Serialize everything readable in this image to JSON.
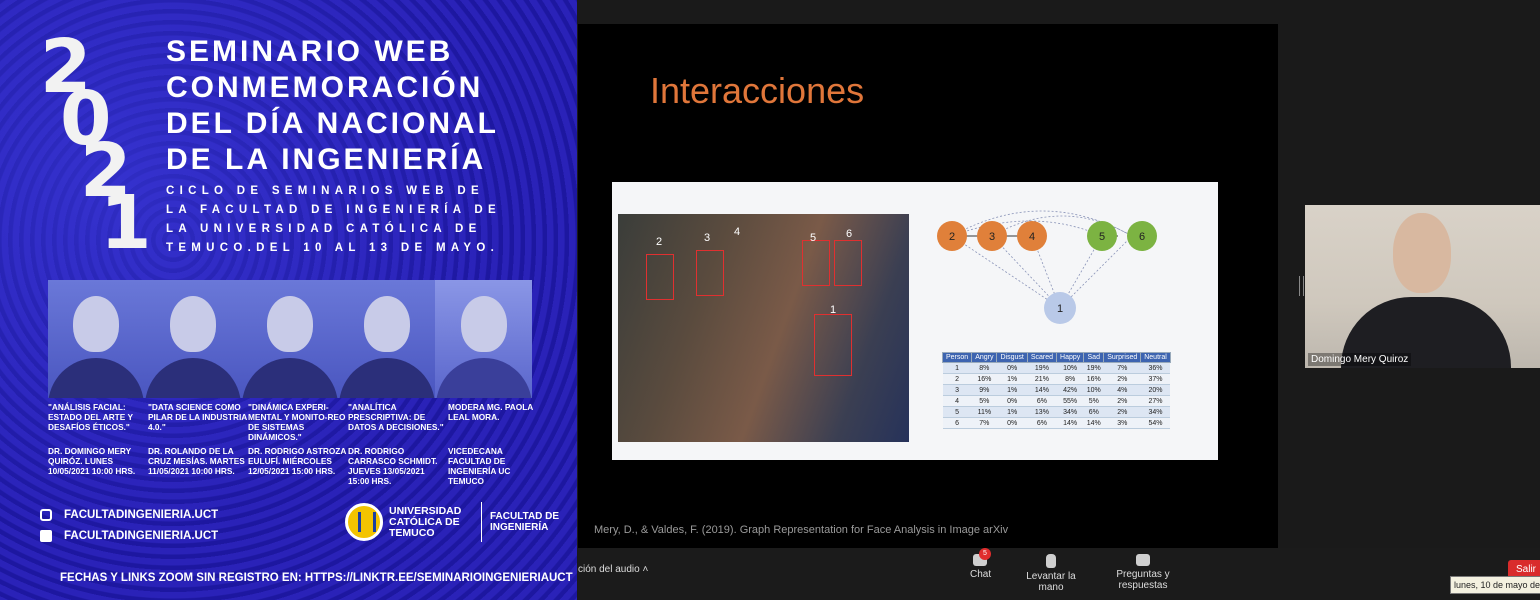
{
  "poster": {
    "year_digits": [
      "2",
      "0",
      "2",
      "1"
    ],
    "title_lines": [
      "SEMINARIO WEB",
      "CONMEMORACIÓN",
      "DEL DÍA NACIONAL",
      "DE LA  INGENIERÍA"
    ],
    "subtitle_lines": [
      "CICLO DE SEMINARIOS WEB DE",
      "LA FACULTAD DE INGENIERÍA DE",
      "LA UNIVERSIDAD CATÓLICA DE",
      "TEMUCO.DEL 10 AL 13 DE MAYO."
    ],
    "speakers": [
      {
        "talk": "\"ANÁLISIS FACIAL: ESTADO DEL ARTE Y DESAFÍOS ÉTICOS.\"",
        "who": "DR.  DOMINGO MERY QUIRÓZ. LUNES 10/05/2021 10:00 HRS."
      },
      {
        "talk": "\"DATA SCIENCE COMO PILAR DE LA INDUSTRIA 4.0.\"",
        "who": "DR. ROLANDO DE LA CRUZ MESÍAS. MARTES 11/05/2021 10:00 HRS."
      },
      {
        "talk": "\"DINÁMICA EXPERI-MENTAL Y MONITO-REO DE SISTEMAS DINÁMICOS.\"",
        "who": "DR. RODRIGO ASTROZA EULUFÍ. MIÉRCOLES 12/05/2021 15:00 HRS."
      },
      {
        "talk": "\"ANALÍTICA PRESCRIPTIVA: DE DATOS A DECISIONES.\"",
        "who": "DR. RODRIGO CARRASCO SCHMIDT. JUEVES 13/05/2021 15:00 HRS."
      },
      {
        "talk": "MODERA MG. PAOLA LEAL MORA.",
        "who": "VICEDECANA FACULTAD DE INGENIERÍA UC TEMUCO"
      }
    ],
    "instagram": "FACULTADINGENIERIA.UCT",
    "facebook": "FACULTADINGENIERIA.UCT",
    "university": "UNIVERSIDAD CATÓLICA DE TEMUCO",
    "faculty": "FACULTAD DE INGENIERÍA",
    "footer": "FECHAS Y LINKS ZOOM SIN REGISTRO EN: HTTPS://LINKTR.EE/SEMINARIOINGENIERIAUCT"
  },
  "slide": {
    "title": "Interacciones",
    "face_labels": [
      "2",
      "3",
      "4",
      "5",
      "6",
      "1"
    ],
    "graph_nodes": [
      "2",
      "3",
      "4",
      "5",
      "6",
      "1"
    ],
    "table_headers": [
      "Person",
      "Angry",
      "Disgust",
      "Scared",
      "Happy",
      "Sad",
      "Surprised",
      "Neutral"
    ],
    "table_rows": [
      [
        "1",
        "8%",
        "0%",
        "19%",
        "10%",
        "19%",
        "7%",
        "36%"
      ],
      [
        "2",
        "16%",
        "1%",
        "21%",
        "8%",
        "16%",
        "2%",
        "37%"
      ],
      [
        "3",
        "9%",
        "1%",
        "14%",
        "42%",
        "10%",
        "4%",
        "20%"
      ],
      [
        "4",
        "5%",
        "0%",
        "6%",
        "55%",
        "5%",
        "2%",
        "27%"
      ],
      [
        "5",
        "11%",
        "1%",
        "13%",
        "34%",
        "6%",
        "2%",
        "34%"
      ],
      [
        "6",
        "7%",
        "0%",
        "6%",
        "14%",
        "14%",
        "3%",
        "54%"
      ]
    ],
    "citation": "Mery, D., & Valdes, F. (2019). Graph Representation for Face Analysis in Image arXiv"
  },
  "participant": {
    "name": "Domingo Mery Quiroz"
  },
  "toolbar": {
    "audio_label": "ción del audio  ˄",
    "chat_label": "Chat",
    "chat_badge": "5",
    "raise_hand_label": "Levantar la mano",
    "qa_label": "Preguntas y respuestas",
    "leave_label": "Salir"
  },
  "tooltip": "lunes, 10 de mayo de",
  "colors": {
    "poster_blue": "#2320b0",
    "slide_title": "#e0763a",
    "node_orange": "#e0803a",
    "node_green": "#7cb342",
    "node_blue": "#b9c9e8",
    "leave_red": "#d92b2b"
  }
}
